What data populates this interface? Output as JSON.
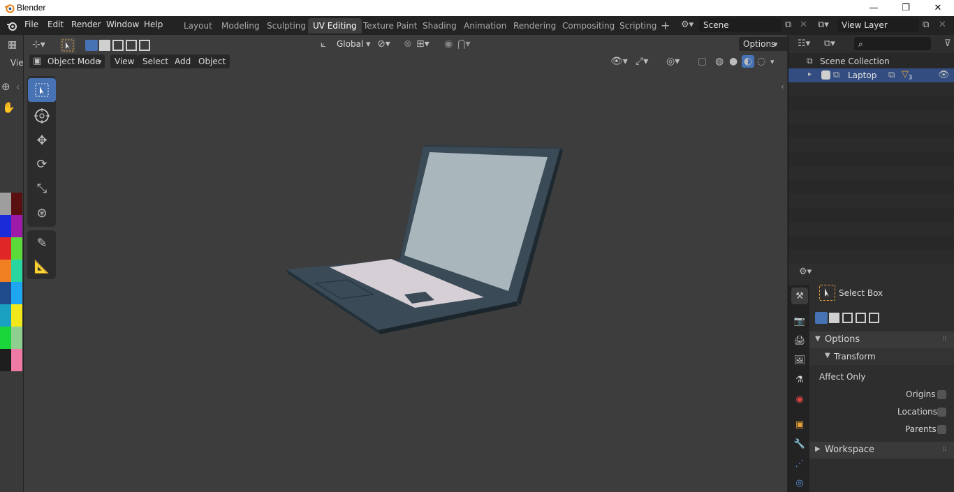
{
  "window": {
    "title": "Blender"
  },
  "menus": [
    "File",
    "Edit",
    "Render",
    "Window",
    "Help"
  ],
  "workspaces": [
    "Layout",
    "Modeling",
    "Sculpting",
    "UV Editing",
    "Texture Paint",
    "Shading",
    "Animation",
    "Rendering",
    "Compositing",
    "Scripting"
  ],
  "active_workspace": "UV Editing",
  "scene": {
    "name": "Scene"
  },
  "view_layer": {
    "name": "View Layer"
  },
  "viewport": {
    "mode": "Object Mode",
    "header_menus": [
      "View",
      "Select",
      "Add",
      "Object"
    ],
    "orientation": "Global",
    "options_label": "Options",
    "left_edge_label": "Vie"
  },
  "outliner": {
    "collection_label": "Scene Collection",
    "item_label": "Laptop",
    "filter_count": "3"
  },
  "properties": {
    "tool_name": "Select Box",
    "options_label": "Options",
    "transform_label": "Transform",
    "affect_only_label": "Affect Only",
    "origins_label": "Origins",
    "locations_label": "Locations",
    "parents_label": "Parents",
    "workspace_label": "Workspace"
  },
  "colors": {
    "accent": "#4772b3",
    "laptop_body": "#3a4b57",
    "laptop_screen": "#a9b7bd",
    "keys": "#d7cfd6"
  },
  "palette_swatches": [
    "#9e9e9e",
    "#5a1010",
    "#1a2cd9",
    "#9d1aa8",
    "#e02727",
    "#5adb3a",
    "#f07f22",
    "#2ad6a0",
    "#1f4a8c",
    "#1ea6f0",
    "#1aa0c0",
    "#f0e81a",
    "#1ad63a",
    "#8fcf8f",
    "#1e1e1e",
    "#f07aa6"
  ]
}
